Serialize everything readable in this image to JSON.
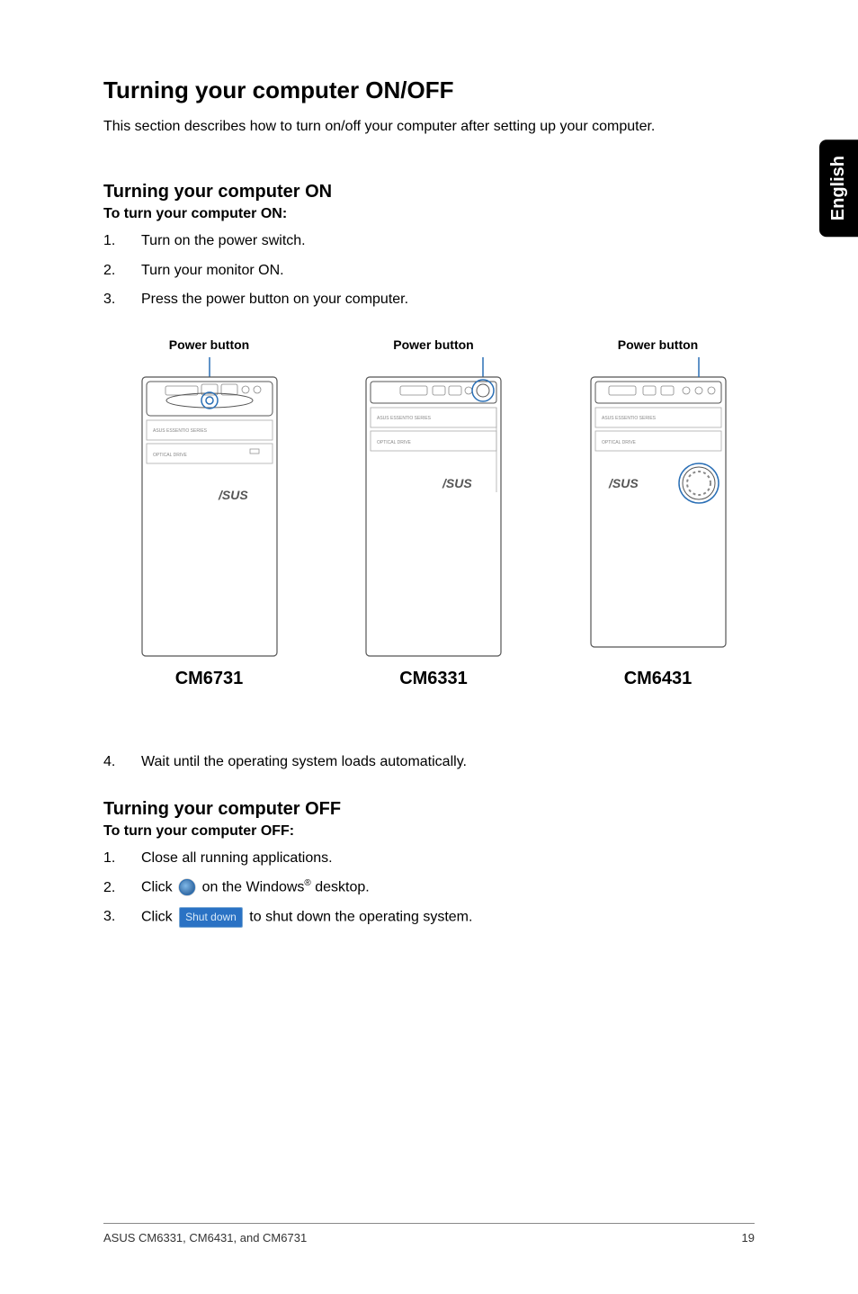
{
  "side_tab": "English",
  "title": "Turning your computer ON/OFF",
  "intro": "This section describes how to turn on/off your computer after setting up your computer.",
  "on": {
    "heading": "Turning your computer ON",
    "sub": "To turn your computer ON:",
    "steps": [
      "Turn on the power switch.",
      "Turn your monitor ON.",
      "Press the power button on your computer."
    ],
    "step_after": "Wait until the operating system loads automatically."
  },
  "figures": {
    "power_label": "Power button",
    "models": [
      "CM6731",
      "CM6331",
      "CM6431"
    ]
  },
  "off": {
    "heading": "Turning your computer OFF",
    "sub": "To turn your computer OFF:",
    "steps": {
      "s1": "Close all running applications.",
      "s2_a": "Click",
      "s2_b": "on the Windows",
      "s2_c": "desktop.",
      "s3_a": "Click",
      "s3_b": "to shut down the operating system.",
      "shutdown_label": "Shut down"
    }
  },
  "footer": {
    "left": "ASUS CM6331, CM6431, and CM6731",
    "right": "19"
  }
}
